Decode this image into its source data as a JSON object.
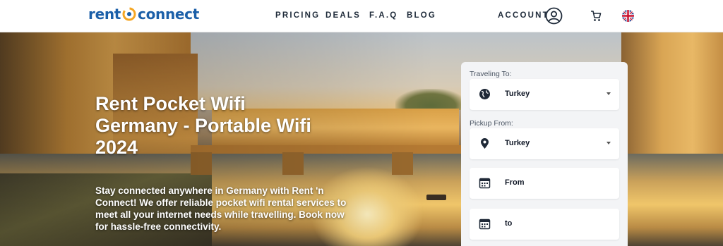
{
  "brand": {
    "part1": "rent",
    "part2": "connect",
    "logo_icon": "swirl-logo-icon",
    "color": "#1b5fa8"
  },
  "nav": {
    "pricing": "PRICING",
    "deals": "DEALS",
    "faq": "F.A.Q",
    "blog": "BLOG"
  },
  "header": {
    "account_label": "ACCOUNT",
    "account_icon": "user-circle-icon",
    "cart_icon": "cart-icon",
    "language_icon": "uk-flag-icon"
  },
  "hero": {
    "title": "Rent Pocket Wifi Germany - Portable Wifi 2024",
    "description": "Stay connected anywhere in Germany with Rent 'n Connect! We offer reliable pocket wifi rental services to meet all your internet needs while travelling. Book now for hassle-free connectivity."
  },
  "booking": {
    "traveling_to_label": "Traveling To:",
    "traveling_to_value": "Turkey",
    "pickup_from_label": "Pickup From:",
    "pickup_from_value": "Turkey",
    "from_placeholder": "From",
    "to_placeholder": "to"
  }
}
